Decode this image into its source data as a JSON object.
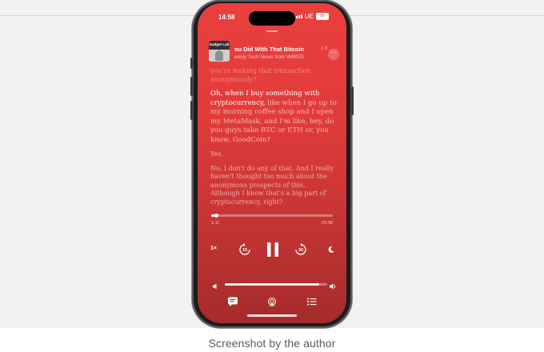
{
  "status_bar": {
    "time": "14:58",
    "carrier": "UE",
    "battery": "50"
  },
  "now_playing": {
    "episode_title": "ou Did With That Bitcoin",
    "show_subtitle": "eekly Tech News from WIRED",
    "header_tag": "1 K",
    "artwork_text": "Gadget Lab",
    "more_label": "···"
  },
  "transcript": {
    "faded_line": "you're making that transaction anonymously?",
    "active_highlight": "Oh, when I buy something with cryptocurrency,",
    "active_rest": " like when I go up to my morning coffee shop and I open my MetaMask, and I'm like, hey, do you guys take BTC or ETH or, you know, GoodCoin?",
    "reply": "Yes.",
    "next": "No, I don't do any of that. And I really haven't thought too much about the anonymous prospects of this. Although I know that's a big part of cryptocurrency, right?"
  },
  "playback": {
    "elapsed": "1:11",
    "remaining": "-29:38",
    "progress_fraction": 0.04,
    "speed": "1×",
    "skip_back_seconds": "15",
    "skip_forward_seconds": "30",
    "volume_fraction": 0.92
  },
  "caption": "Screenshot by the author"
}
